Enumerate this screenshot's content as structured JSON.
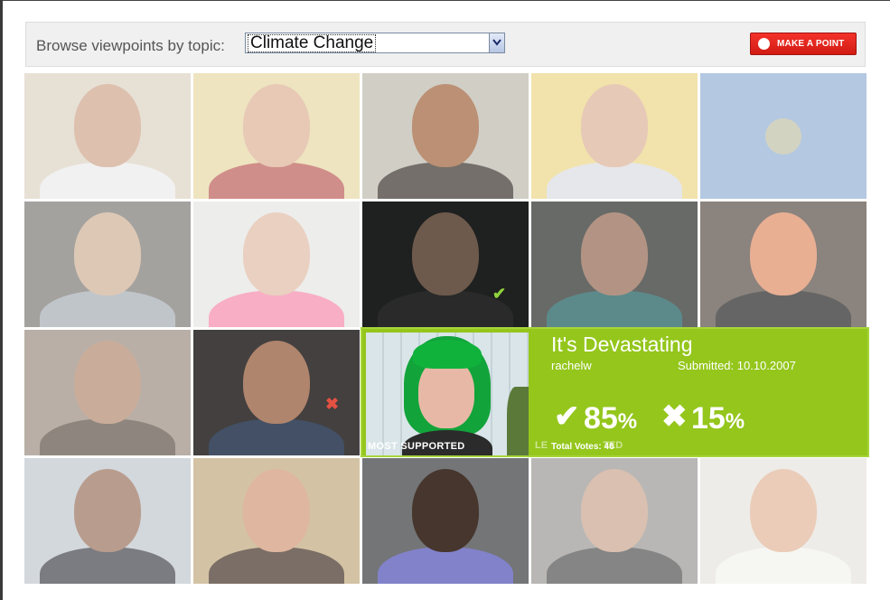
{
  "toolbar": {
    "browse_label": "Browse viewpoints by topic:",
    "topic_selected": "Climate Change",
    "make_point_label": "MAKE A POINT",
    "accent_color": "#e0231a"
  },
  "grid": {
    "rows": 4,
    "columns": 5
  },
  "featured": {
    "title": "It's Devastating",
    "username": "rachelw",
    "submitted": "Submitted: 10.10.2007",
    "support_percent": "85",
    "oppose_percent": "15",
    "percent_sign": "%",
    "total_votes": "Total Votes: 46",
    "badge": "MOST SUPPORTED",
    "ghost_badge": "LE",
    "ghost_badge_tail": "TED",
    "panel_color": "#94c61c"
  },
  "icons": {
    "check": "check-icon",
    "cross": "cross-icon",
    "record": "record-icon",
    "dropdown": "chevron-down-icon"
  }
}
